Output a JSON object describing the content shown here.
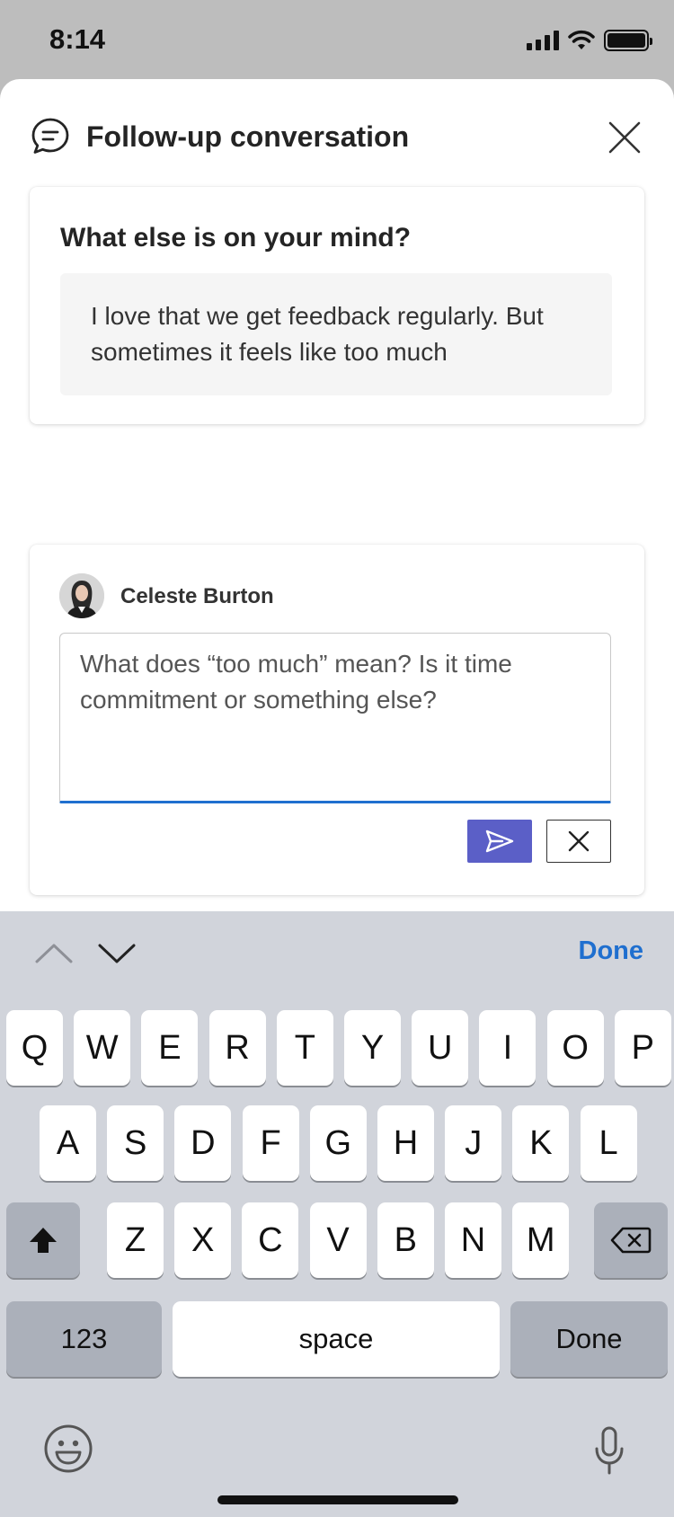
{
  "status_bar": {
    "time": "8:14"
  },
  "sheet": {
    "title": "Follow-up conversation",
    "question": "What else is on your mind?",
    "answer": "I love that we get feedback regularly. But sometimes it feels like too much"
  },
  "reply": {
    "author": "Celeste Burton",
    "message": "What does “too much” mean? Is it time commitment or something else?"
  },
  "keyboard": {
    "toolbar_done": "Done",
    "row1": [
      "Q",
      "W",
      "E",
      "R",
      "T",
      "Y",
      "U",
      "I",
      "O",
      "P"
    ],
    "row2": [
      "A",
      "S",
      "D",
      "F",
      "G",
      "H",
      "J",
      "K",
      "L"
    ],
    "row3": [
      "Z",
      "X",
      "C",
      "V",
      "B",
      "N",
      "M"
    ],
    "numbers_key": "123",
    "space_key": "space",
    "done_key": "Done"
  },
  "colors": {
    "accent": "#5b5fc7",
    "link": "#1f6fcf",
    "keyboard_bg": "#d1d4db"
  }
}
